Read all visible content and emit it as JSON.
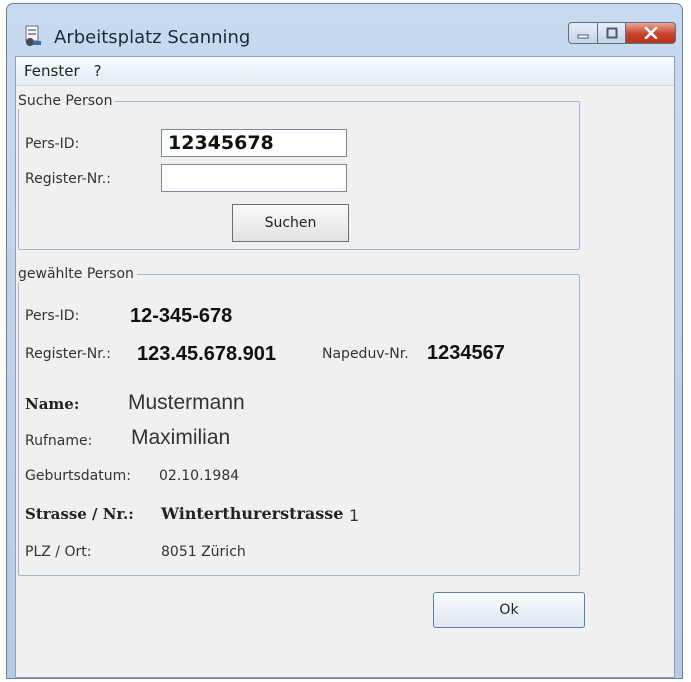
{
  "window": {
    "title": "Arbeitsplatz Scanning",
    "icons": [
      "scanner-app-icon",
      "minimize-icon",
      "maximize-icon",
      "close-icon"
    ],
    "colors": {
      "close_button": "#c7432c",
      "group_border": "#9fb6d1"
    }
  },
  "menu": {
    "items": [
      "Fenster",
      "?"
    ]
  },
  "search": {
    "legend": "Suche Person",
    "pers_id_label": "Pers-ID:",
    "pers_id_value": "12345678",
    "register_label": "Register-Nr.:",
    "register_value": "",
    "search_button": "Suchen"
  },
  "selected": {
    "legend": "gewählte Person",
    "pers_id_label": "Pers-ID:",
    "pers_id_value": "12-345-678",
    "register_label": "Register-Nr.:",
    "register_value": "123.45.678.901",
    "napeduv_label": "Napeduv-Nr.",
    "napeduv_value": "1234567",
    "name_label": "Name:",
    "name_value": "Mustermann",
    "rufname_label": "Rufname:",
    "rufname_value": "Maximilian",
    "birth_label": "Geburtsdatum:",
    "birth_value": "02.10.1984",
    "street_label": "Strasse / Nr.:",
    "street_value": "Winterthurerstrasse",
    "street_number": "1",
    "plz_label": "PLZ / Ort:",
    "plz_value": "8051 Zürich"
  },
  "footer": {
    "ok_button": "Ok"
  }
}
